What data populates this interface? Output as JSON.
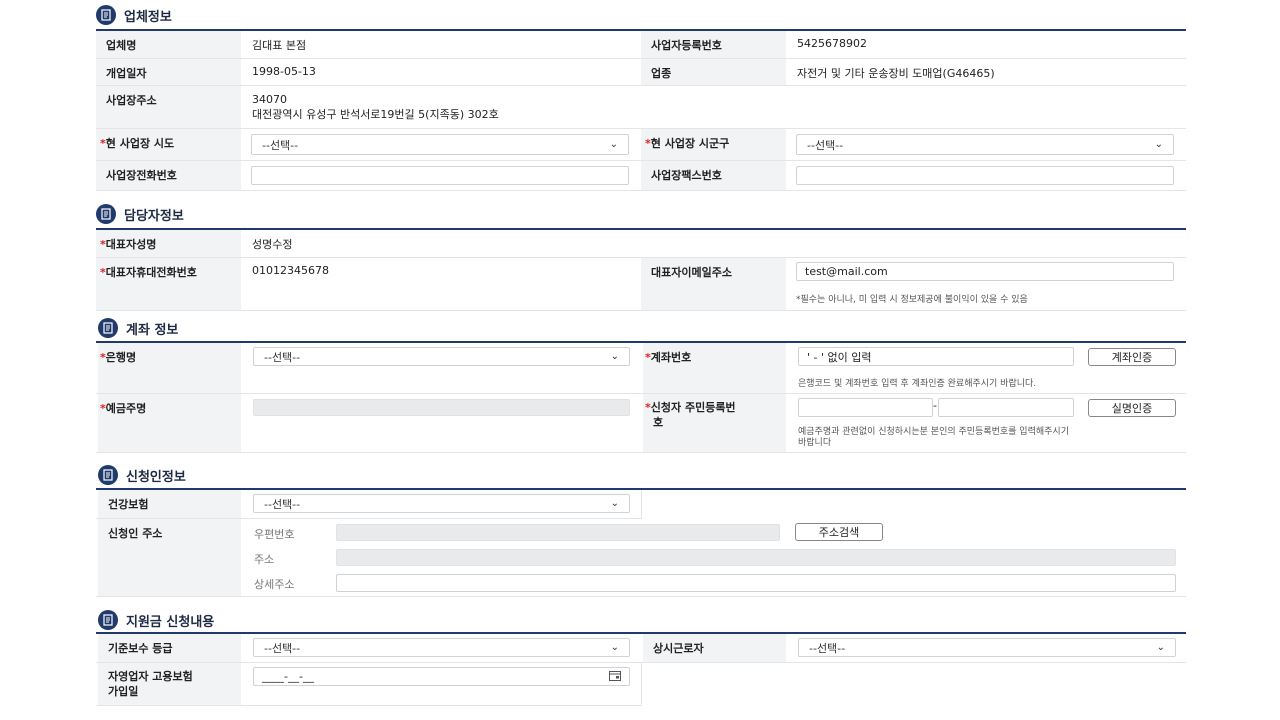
{
  "sections": {
    "company": "업체정보",
    "manager": "담당자정보",
    "account": "계좌 정보",
    "applicant": "신청인정보",
    "subsidy": "지원금 신청내용"
  },
  "company": {
    "name_label": "업체명",
    "name_value": "김대표 본점",
    "bizno_label": "사업자등록번호",
    "bizno_value": "5425678902",
    "open_label": "개업일자",
    "open_value": "1998-05-13",
    "industry_label": "업종",
    "industry_value": "자전거 및 기타 운송장비 도매업(G46465)",
    "addr_label": "사업장주소",
    "addr_zip": "34070",
    "addr_line": "대전광역시 유성구 반석서로19번길 5(지족동) 302호",
    "sido_label": "현 사업장 시도",
    "sido_value": "--선택--",
    "sigungu_label": "현 사업장 시군구",
    "sigungu_value": "--선택--",
    "phone_label": "사업장전화번호",
    "phone_value": "",
    "fax_label": "사업장팩스번호",
    "fax_value": ""
  },
  "manager": {
    "name_label": "대표자성명",
    "name_value": "성명수정",
    "mobile_label": "대표자휴대전화번호",
    "mobile_value": "01012345678",
    "email_label": "대표자이메일주소",
    "email_value": "test@mail.com",
    "email_hint": "*필수는 아니나, 미 입력 시 정보제공에 불이익이 있을 수 있음"
  },
  "account": {
    "bank_label": "은행명",
    "bank_value": "--선택--",
    "accno_label": "계좌번호",
    "accno_placeholder": "' - ' 없이 입력",
    "verify_btn": "계좌인증",
    "accno_hint": "은행코드 및 계좌번호 입력 후 계좌인증 완료해주시기 바랍니다.",
    "holder_label": "예금주명",
    "holder_value": "",
    "rrn_label_1": "신청자 주민등록번",
    "rrn_label_2": "호",
    "rrn_sep": "-",
    "realname_btn": "실명인증",
    "rrn_hint_1": "예금주명과 관련없이 신청하시는분 본인의 주민등록번호를 입력해주시기",
    "rrn_hint_2": "바랍니다"
  },
  "applicant": {
    "insurance_label": "건강보험",
    "insurance_value": "--선택--",
    "address_label": "신청인 주소",
    "zip_label": "우편번호",
    "search_btn": "주소검색",
    "addr_label": "주소",
    "detail_label": "상세주소"
  },
  "subsidy": {
    "grade_label": "기준보수 등급",
    "grade_value": "--선택--",
    "worker_label": "상시근로자",
    "worker_value": "--선택--",
    "join_label_1": "자영업자 고용보험",
    "join_label_2": "가입일",
    "join_value": "____-__-__"
  }
}
